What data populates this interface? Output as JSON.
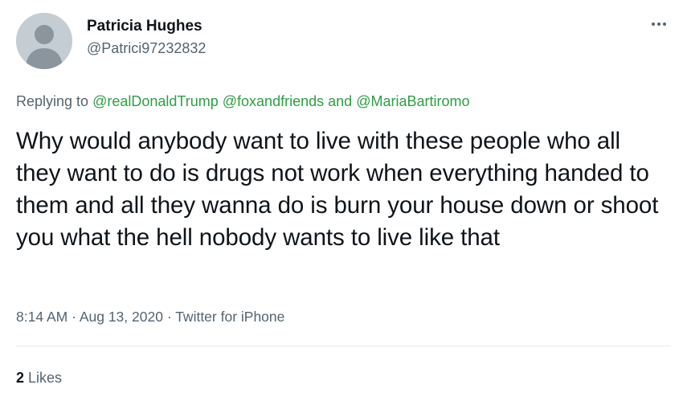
{
  "user": {
    "display_name": "Patricia Hughes",
    "handle": "@Patrici97232832",
    "avatar": "default-avatar-icon"
  },
  "more_menu": {
    "icon": "more-horizontal-icon"
  },
  "reply": {
    "prefix": "Replying to",
    "mention_1": "@realDonaldTrump",
    "mention_2": "@foxandfriends",
    "conjunction": "and",
    "mention_3": "@MariaBartiromo"
  },
  "tweet": {
    "text": "Why would anybody want to live with these people who all they want to do is drugs not work when everything handed to them and all they wanna do is burn your house down or shoot you what the hell nobody wants to live like that"
  },
  "meta": {
    "time": "8:14 AM",
    "date": "Aug 13, 2020",
    "separator": "·",
    "source": "Twitter for iPhone"
  },
  "engagement": {
    "likes_count": "2",
    "likes_label": "Likes"
  },
  "colors": {
    "link": "#2e9e44",
    "secondary_text": "#536471",
    "primary_text": "#0f1419",
    "avatar_bg": "#c5cdd4"
  }
}
